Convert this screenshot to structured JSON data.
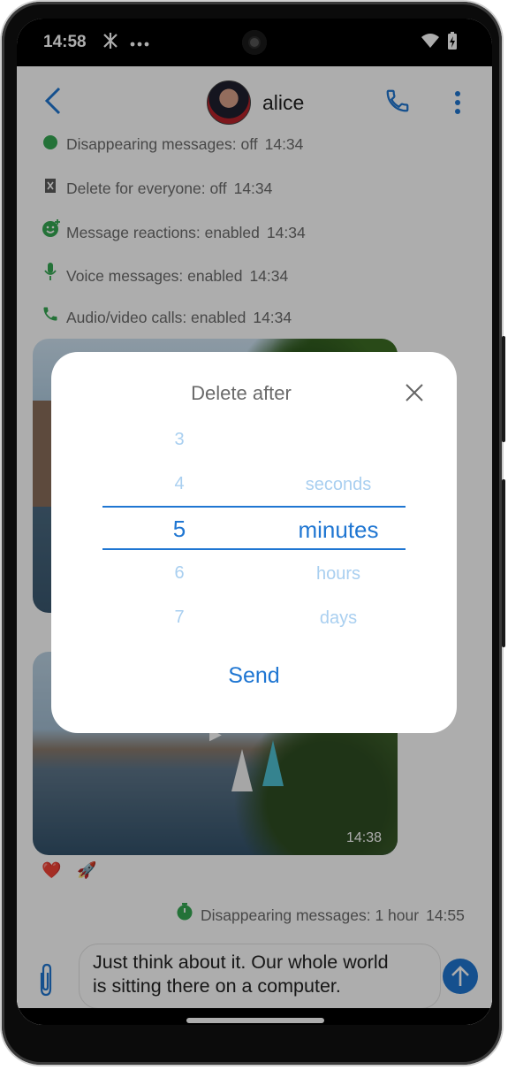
{
  "status_bar": {
    "time": "14:58",
    "icons": [
      "network-icon",
      "more-dots-icon",
      "wifi-icon",
      "battery-icon"
    ]
  },
  "app_bar": {
    "contact_name": "alice",
    "icons": [
      "back-arrow-icon",
      "phone-icon",
      "more-vert-icon"
    ]
  },
  "chat": {
    "system_items": [
      {
        "icon": "timer-icon",
        "text": "Disappearing messages: off",
        "time": "14:34"
      },
      {
        "icon": "trash-icon",
        "text": "Delete for everyone: off",
        "time": "14:34"
      },
      {
        "icon": "emoji-icon",
        "text": "Message reactions: enabled",
        "time": "14:34"
      },
      {
        "icon": "mic-icon",
        "text": "Voice messages: enabled",
        "time": "14:34"
      },
      {
        "icon": "phone-icon",
        "text": "Audio/video calls: enabled",
        "time": "14:34"
      }
    ],
    "video_time": "14:38",
    "reactions": [
      "❤️",
      "🚀"
    ],
    "timer_line": {
      "text": "Disappearing messages: 1 hour",
      "time": "14:55"
    }
  },
  "compose": {
    "message_line1": "Just think about it. Our whole world",
    "message_line2": "is sitting there on a computer."
  },
  "dialog": {
    "title": "Delete after",
    "numbers": [
      "3",
      "4",
      "5",
      "6",
      "7"
    ],
    "units": [
      "seconds",
      "minutes",
      "hours",
      "days"
    ],
    "selected_number": "5",
    "selected_unit": "minutes",
    "send_label": "Send"
  },
  "colors": {
    "accent": "#1f76d2",
    "picker_faded": "#a9cff0",
    "status_green": "#35a853"
  }
}
